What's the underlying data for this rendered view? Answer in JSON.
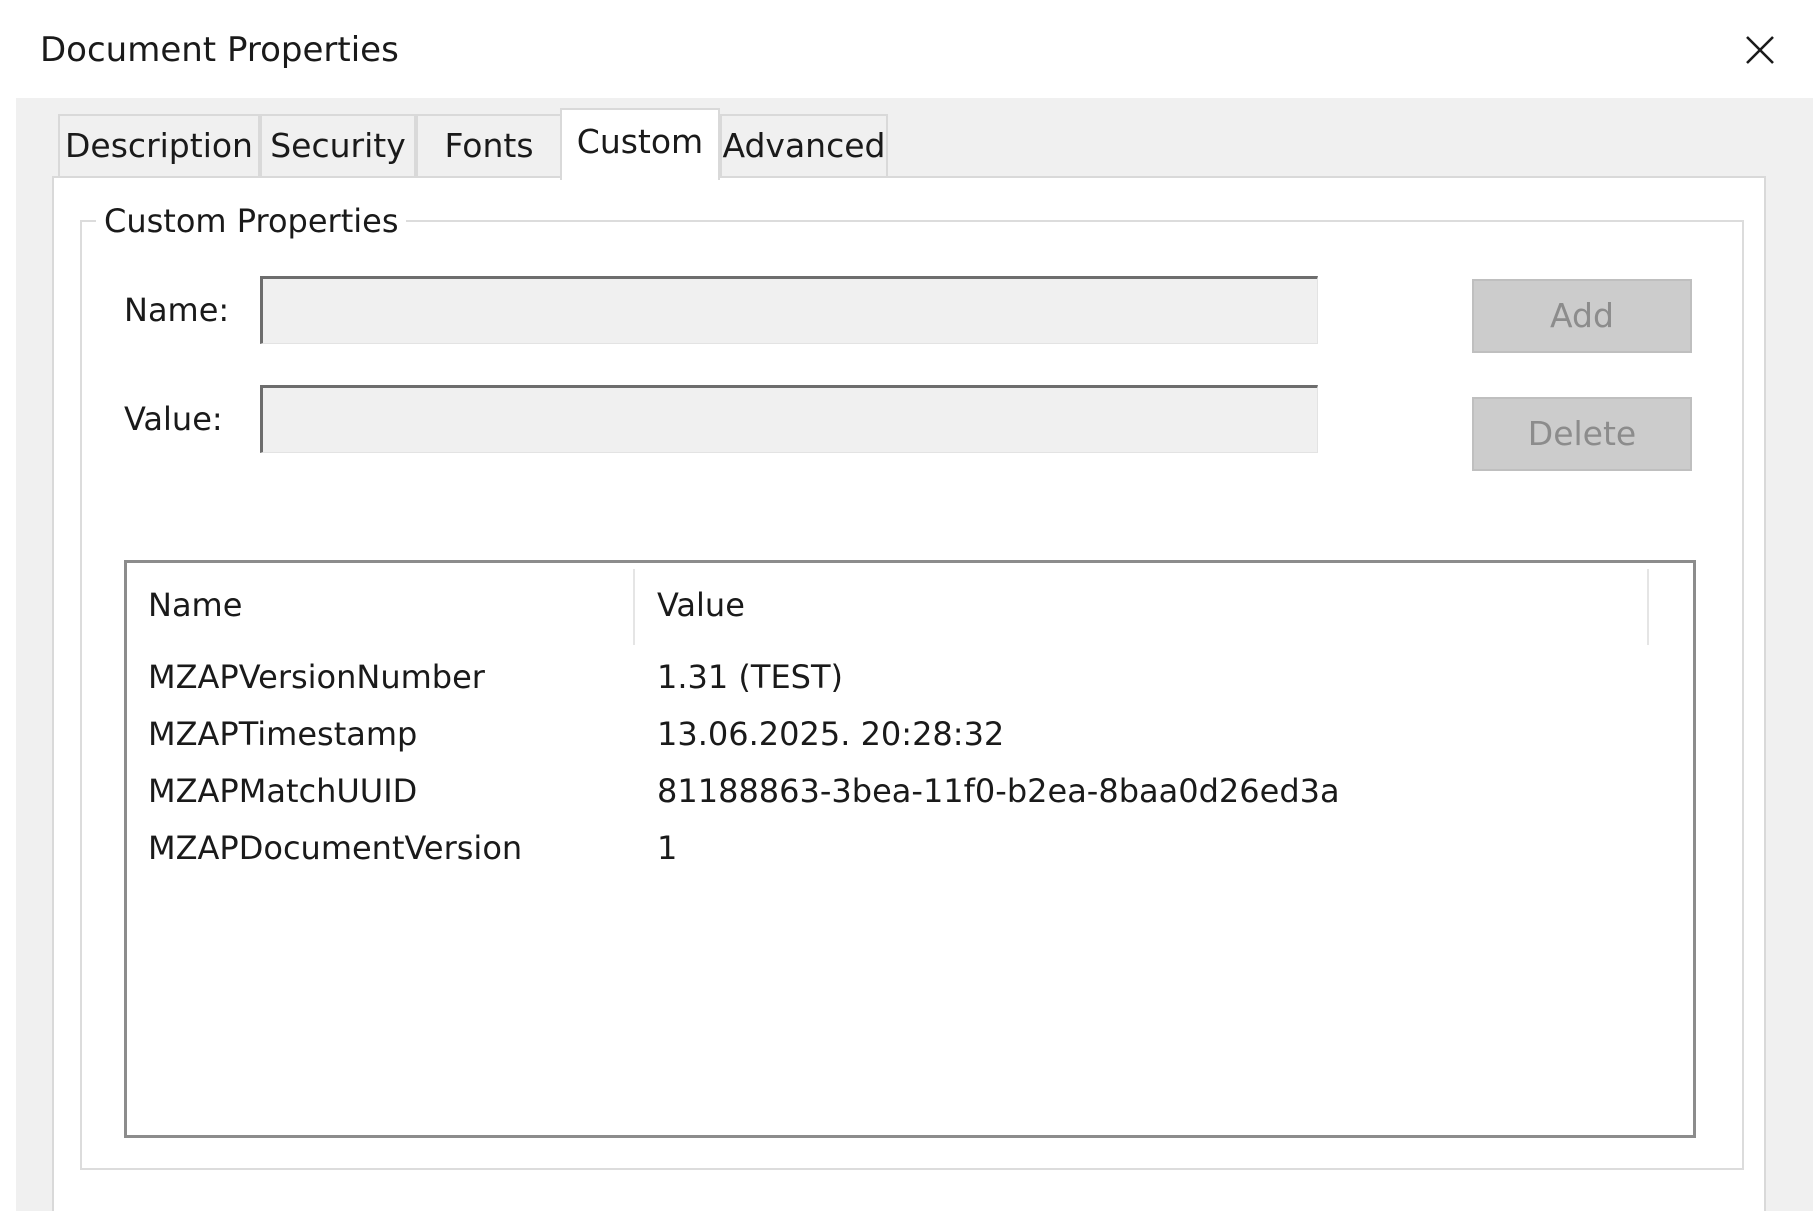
{
  "window": {
    "title": "Document Properties",
    "close_icon": "close-icon"
  },
  "tabs": [
    {
      "label": "Description",
      "active": false
    },
    {
      "label": "Security",
      "active": false
    },
    {
      "label": "Fonts",
      "active": false
    },
    {
      "label": "Custom",
      "active": true
    },
    {
      "label": "Advanced",
      "active": false
    }
  ],
  "custom": {
    "group_title": "Custom Properties",
    "name_label": "Name:",
    "name_value": "",
    "value_label": "Value:",
    "value_value": "",
    "add_label": "Add",
    "delete_label": "Delete",
    "buttons_enabled": false,
    "table": {
      "columns": [
        "Name",
        "Value"
      ],
      "rows": [
        {
          "name": "MZAPVersionNumber",
          "value": "1.31 (TEST)"
        },
        {
          "name": "MZAPTimestamp",
          "value": "13.06.2025. 20:28:32"
        },
        {
          "name": "MZAPMatchUUID",
          "value": "81188863-3bea-11f0-b2ea-8baa0d26ed3a"
        },
        {
          "name": "MZAPDocumentVersion",
          "value": "1"
        }
      ]
    }
  },
  "colors": {
    "client_bg": "#f0f0f0",
    "panel_bg": "#ffffff",
    "disabled_button_bg": "#cccccc",
    "disabled_button_text": "#8c8c8c"
  }
}
